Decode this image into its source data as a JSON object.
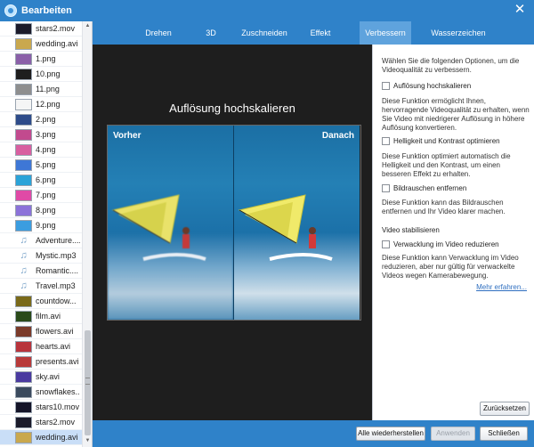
{
  "window": {
    "title": "Bearbeiten",
    "close_glyph": "✕"
  },
  "files": [
    {
      "name": "stars2.mov",
      "kind": "video",
      "color": "#1a1a2a"
    },
    {
      "name": "wedding.avi",
      "kind": "video",
      "color": "#c9a84e"
    },
    {
      "name": "1.png",
      "kind": "image",
      "color": "#8a5fa8"
    },
    {
      "name": "10.png",
      "kind": "image",
      "color": "#1e1e1e"
    },
    {
      "name": "11.png",
      "kind": "image",
      "color": "#8e8e8e"
    },
    {
      "name": "12.png",
      "kind": "image",
      "color": "#f5f5f5"
    },
    {
      "name": "2.png",
      "kind": "image",
      "color": "#2d4b8a"
    },
    {
      "name": "3.png",
      "kind": "image",
      "color": "#c24a8e"
    },
    {
      "name": "4.png",
      "kind": "image",
      "color": "#d85fa0"
    },
    {
      "name": "5.png",
      "kind": "image",
      "color": "#3e77d6"
    },
    {
      "name": "6.png",
      "kind": "image",
      "color": "#2aa3d8"
    },
    {
      "name": "7.png",
      "kind": "image",
      "color": "#e04aa6"
    },
    {
      "name": "8.png",
      "kind": "image",
      "color": "#8b72d9"
    },
    {
      "name": "9.png",
      "kind": "image",
      "color": "#3b9de0"
    },
    {
      "name": "Adventure....",
      "kind": "audio",
      "color": ""
    },
    {
      "name": "Mystic.mp3",
      "kind": "audio",
      "color": ""
    },
    {
      "name": "Romantic....",
      "kind": "audio",
      "color": ""
    },
    {
      "name": "Travel.mp3",
      "kind": "audio",
      "color": ""
    },
    {
      "name": "countdow...",
      "kind": "video",
      "color": "#7a6a1a"
    },
    {
      "name": "film.avi",
      "kind": "video",
      "color": "#2a4a1a"
    },
    {
      "name": "flowers.avi",
      "kind": "video",
      "color": "#7a3a2a"
    },
    {
      "name": "hearts.avi",
      "kind": "video",
      "color": "#b8343c"
    },
    {
      "name": "presents.avi",
      "kind": "video",
      "color": "#b83a3a"
    },
    {
      "name": "sky.avi",
      "kind": "video",
      "color": "#4a3aa0"
    },
    {
      "name": "snowflakes...",
      "kind": "video",
      "color": "#3a4a5e"
    },
    {
      "name": "stars10.mov",
      "kind": "video",
      "color": "#141428"
    },
    {
      "name": "stars2.mov",
      "kind": "video",
      "color": "#1a1a2a"
    },
    {
      "name": "wedding.avi",
      "kind": "video",
      "color": "#c9a84e",
      "selected": true
    }
  ],
  "tabs": [
    {
      "label": "Drehen",
      "active": false
    },
    {
      "label": "3D",
      "active": false
    },
    {
      "label": "Zuschneiden",
      "active": false
    },
    {
      "label": "Effekt",
      "active": false
    },
    {
      "label": "Verbessern",
      "active": true
    },
    {
      "label": "Wasserzeichen",
      "active": false
    }
  ],
  "preview": {
    "heading": "Auflösung hochskalieren",
    "before_label": "Vorher",
    "after_label": "Danach"
  },
  "panel": {
    "intro": "Wählen Sie die folgenden Optionen, um die Videoqualität zu verbessern.",
    "opt1_label": "Auflösung hochskalieren",
    "opt1_desc": "Diese Funktion ermöglicht Ihnen, hervorragende Videoqualität zu erhalten, wenn Sie Video mit niedrigerer Auflösung in höhere Auflösung konvertieren.",
    "opt2_label": "Helligkeit und Kontrast optimieren",
    "opt2_desc": "Diese Funktion optimiert automatisch die Helligkeit und den Kontrast, um einen besseren Effekt zu erhalten.",
    "opt3_label": "Bildrauschen entfernen",
    "opt3_desc": "Diese Funktion kann das Bildrauschen entfernen und Ihr Video klarer machen.",
    "section_label": "Video stabilisieren",
    "opt4_label": "Verwacklung im Video reduzieren",
    "opt4_desc": "Diese Funktion kann Verwacklung im Video reduzieren, aber nur gültig für verwackelte Videos wegen Kamerabewegung.",
    "more_link": "Mehr erfahren..."
  },
  "buttons": {
    "reset": "Zurücksetzen",
    "restore_all": "Alle wiederherstellen",
    "apply": "Anwenden",
    "close": "Schließen"
  },
  "colors": {
    "accent": "#2f82c9",
    "active_tab": "#5fa3dd",
    "preview_bg": "#1e1e1e"
  }
}
